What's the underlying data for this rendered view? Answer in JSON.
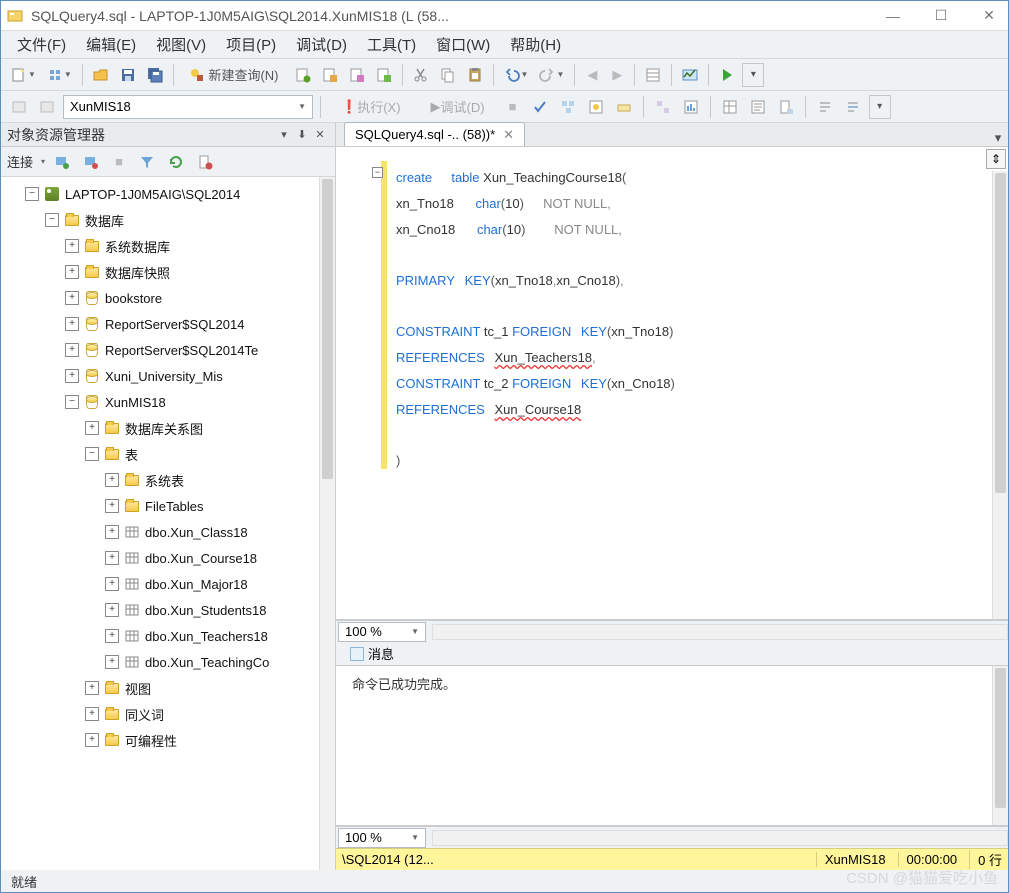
{
  "title": "SQLQuery4.sql - LAPTOP-1J0M5AIG\\SQL2014.XunMIS18 (L                        (58...",
  "menu": [
    "文件(F)",
    "编辑(E)",
    "视图(V)",
    "项目(P)",
    "调试(D)",
    "工具(T)",
    "窗口(W)",
    "帮助(H)"
  ],
  "toolbar": {
    "new_query": "新建查询(N)"
  },
  "toolbar2": {
    "db": "XunMIS18",
    "execute": "执行(X)",
    "debug": "调试(D)"
  },
  "explorer": {
    "title": "对象资源管理器",
    "connect": "连接",
    "tree": [
      {
        "lvl": 1,
        "tog": "-",
        "icon": "server",
        "label": "LAPTOP-1J0M5AIG\\SQL2014"
      },
      {
        "lvl": 2,
        "tog": "-",
        "icon": "folder",
        "label": "数据库"
      },
      {
        "lvl": 3,
        "tog": "+",
        "icon": "folder",
        "label": "系统数据库"
      },
      {
        "lvl": 3,
        "tog": "+",
        "icon": "folder",
        "label": "数据库快照"
      },
      {
        "lvl": 3,
        "tog": "+",
        "icon": "db",
        "label": "bookstore"
      },
      {
        "lvl": 3,
        "tog": "+",
        "icon": "db",
        "label": "ReportServer$SQL2014"
      },
      {
        "lvl": 3,
        "tog": "+",
        "icon": "db",
        "label": "ReportServer$SQL2014Te"
      },
      {
        "lvl": 3,
        "tog": "+",
        "icon": "db",
        "label": "Xuni_University_Mis"
      },
      {
        "lvl": 3,
        "tog": "-",
        "icon": "db",
        "label": "XunMIS18"
      },
      {
        "lvl": 4,
        "tog": "+",
        "icon": "folder",
        "label": "数据库关系图"
      },
      {
        "lvl": 4,
        "tog": "-",
        "icon": "folder",
        "label": "表"
      },
      {
        "lvl": 5,
        "tog": "+",
        "icon": "folder",
        "label": "系统表"
      },
      {
        "lvl": 5,
        "tog": "+",
        "icon": "folder",
        "label": "FileTables"
      },
      {
        "lvl": 5,
        "tog": "+",
        "icon": "table",
        "label": "dbo.Xun_Class18"
      },
      {
        "lvl": 5,
        "tog": "+",
        "icon": "table",
        "label": "dbo.Xun_Course18"
      },
      {
        "lvl": 5,
        "tog": "+",
        "icon": "table",
        "label": "dbo.Xun_Major18"
      },
      {
        "lvl": 5,
        "tog": "+",
        "icon": "table",
        "label": "dbo.Xun_Students18"
      },
      {
        "lvl": 5,
        "tog": "+",
        "icon": "table",
        "label": "dbo.Xun_Teachers18"
      },
      {
        "lvl": 5,
        "tog": "+",
        "icon": "table",
        "label": "dbo.Xun_TeachingCo"
      },
      {
        "lvl": 4,
        "tog": "+",
        "icon": "folder",
        "label": "视图"
      },
      {
        "lvl": 4,
        "tog": "+",
        "icon": "folder",
        "label": "同义词"
      },
      {
        "lvl": 4,
        "tog": "+",
        "icon": "folder",
        "label": "可编程性"
      }
    ]
  },
  "doc_tab": "SQLQuery4.sql -..                       (58))*",
  "code": {
    "l1a": "create",
    "l1b": "table",
    "l1c": " Xun_TeachingCourse18",
    "l2a": "xn_Tno18      ",
    "l2b": "char",
    "l2c": "10",
    "l2d": "NOT NULL",
    "l3a": "xn_Cno18      ",
    "l3b": "char",
    "l3c": "10",
    "l3d": "NOT NULL",
    "l5a": "PRIMARY",
    "l5b": "KEY",
    "l5c": "xn_Tno18",
    "l5d": "xn_Cno18",
    "l7a": "CONSTRAINT",
    "l7b": " tc_1 ",
    "l7c": "FOREIGN",
    "l7d": "KEY",
    "l7e": "xn_Tno18",
    "l8a": "REFERENCES",
    "l8b": "Xun_Teachers18",
    "l9a": "CONSTRAINT",
    "l9b": " tc_2 ",
    "l9c": "FOREIGN",
    "l9d": "KEY",
    "l9e": "xn_Cno18",
    "l10a": "REFERENCES",
    "l10b": "Xun_Course18",
    "open": "(",
    "close": ")",
    "comma": ",",
    "dot": "."
  },
  "zoom": "100 %",
  "messages": {
    "tab": "消息",
    "body": "命令已成功完成。"
  },
  "conn_status": {
    "server": "\\SQL2014 (12...",
    "db": "XunMIS18",
    "time": "00:00:00",
    "rows": "0 行"
  },
  "status": "就绪",
  "watermark": "CSDN @猫猫爱吃小鱼"
}
